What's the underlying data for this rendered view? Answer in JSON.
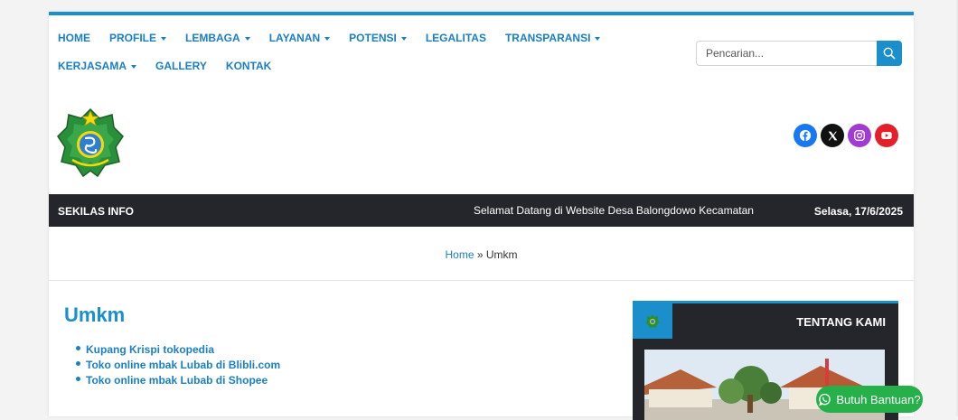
{
  "nav": {
    "row1": [
      {
        "label": "HOME",
        "dropdown": false
      },
      {
        "label": "PROFILE",
        "dropdown": true
      },
      {
        "label": "LEMBAGA",
        "dropdown": true
      },
      {
        "label": "LAYANAN",
        "dropdown": true
      },
      {
        "label": "POTENSI",
        "dropdown": true
      },
      {
        "label": "LEGALITAS",
        "dropdown": false
      },
      {
        "label": "TRANSPARANSI",
        "dropdown": true
      }
    ],
    "row2": [
      {
        "label": "KERJASAMA",
        "dropdown": true
      },
      {
        "label": "GALLERY",
        "dropdown": false
      },
      {
        "label": "KONTAK",
        "dropdown": false
      }
    ]
  },
  "search": {
    "placeholder": "Pencarian...",
    "icon": "search-icon"
  },
  "socials": [
    {
      "name": "facebook-icon",
      "color": "#1877f2"
    },
    {
      "name": "x-icon",
      "color": "#111111"
    },
    {
      "name": "instagram-icon",
      "color": "#a23bd1"
    },
    {
      "name": "youtube-icon",
      "color": "#e3202a"
    }
  ],
  "ticker": {
    "label": "SEKILAS INFO",
    "text": "Selamat Datang di Website Desa Balongdowo Kecamatan",
    "date": "Selasa, 17/6/2025"
  },
  "breadcrumb": {
    "home": "Home",
    "separator": " » ",
    "current": "Umkm"
  },
  "main": {
    "title": "Umkm",
    "links": [
      "Kupang Krispi tokopedia",
      "Toko online mbak Lubab di Blibli.com",
      "Toko online mbak Lubab di Shopee"
    ]
  },
  "widget": {
    "title": "TENTANG KAMI"
  },
  "help_button": {
    "label": "Butuh Bantuan?"
  },
  "colors": {
    "accent": "#1a8fcb",
    "dark": "#24262b",
    "whatsapp": "#25b04a"
  }
}
